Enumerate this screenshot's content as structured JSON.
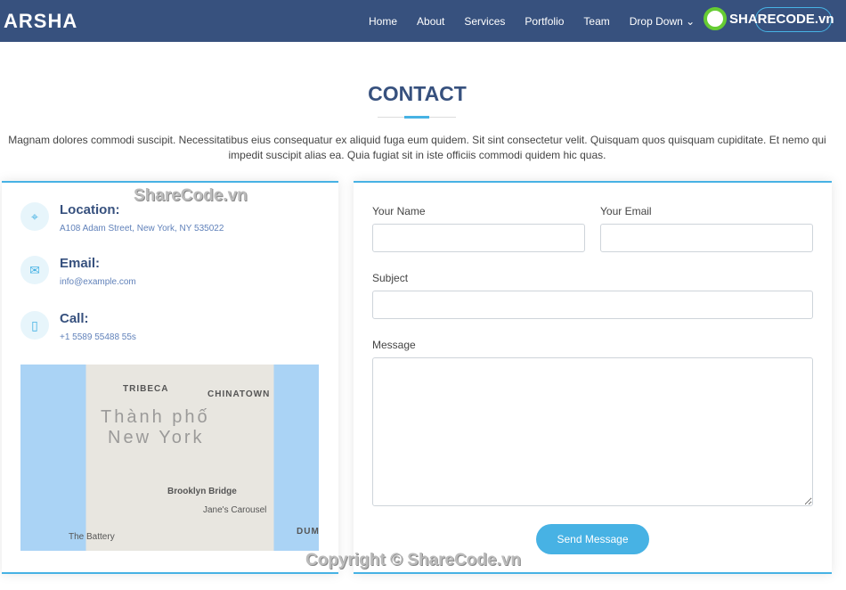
{
  "nav": {
    "logo": "ARSHA",
    "items": [
      "Home",
      "About",
      "Services",
      "Portfolio",
      "Team",
      "Drop Down"
    ],
    "watermark_logo": "SHARECODE.vn"
  },
  "section": {
    "title": "CONTACT",
    "intro": "Magnam dolores commodi suscipit. Necessitatibus eius consequatur ex aliquid fuga eum quidem. Sit sint consectetur velit. Quisquam quos quisquam cupiditate. Et nemo qui impedit suscipit alias ea. Quia fugiat sit in iste officiis commodi quidem hic quas."
  },
  "info": [
    {
      "icon": "map-pin-icon",
      "title": "Location:",
      "text": "A108 Adam Street, New York, NY 535022"
    },
    {
      "icon": "envelope-icon",
      "title": "Email:",
      "text": "info@example.com"
    },
    {
      "icon": "phone-icon",
      "title": "Call:",
      "text": "+1 5589 55488 55s"
    }
  ],
  "map": {
    "labels": [
      "TRIBECA",
      "CHINATOWN",
      "Thành phố",
      "New York",
      "Brooklyn Bridge",
      "Jane's Carousel",
      "The Battery",
      "DUM"
    ]
  },
  "form": {
    "name_label": "Your Name",
    "email_label": "Your Email",
    "subject_label": "Subject",
    "message_label": "Message",
    "submit": "Send Message",
    "name": "",
    "email": "",
    "subject": "",
    "message": ""
  },
  "watermarks": [
    "ShareCode.vn",
    "Copyright © ShareCode.vn"
  ],
  "colors": {
    "nav": "#37517e",
    "accent": "#47b2e4"
  }
}
